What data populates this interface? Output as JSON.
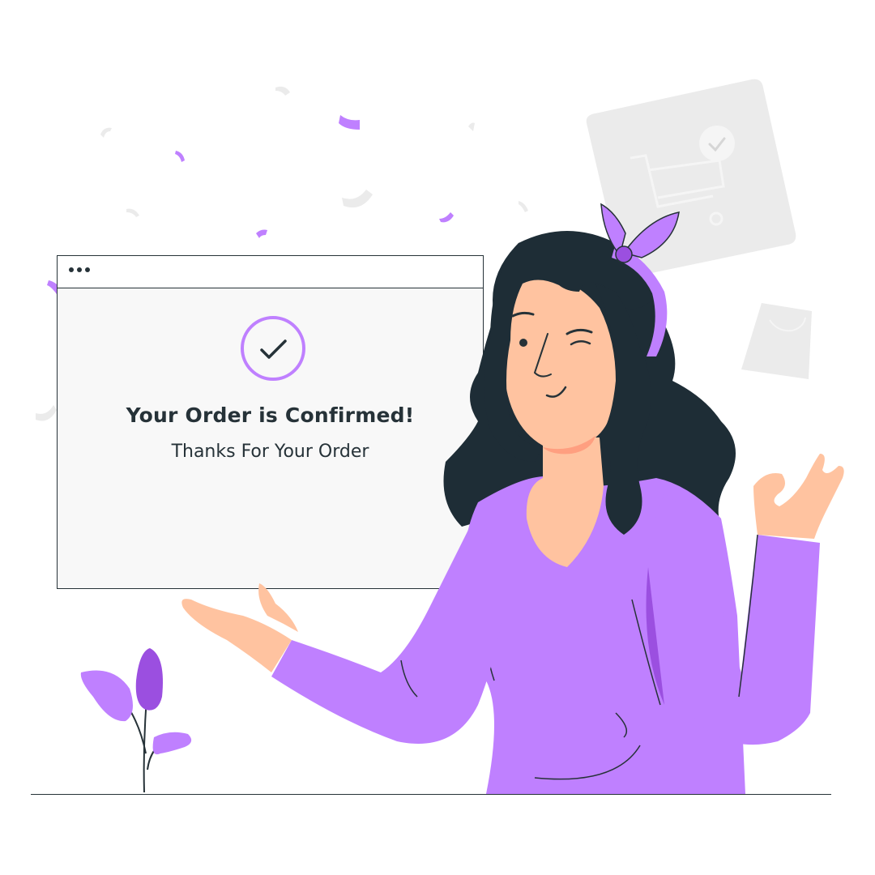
{
  "confirmation": {
    "title": "Your Order is Confirmed!",
    "subtitle": "Thanks For Your Order"
  },
  "icons": {
    "window_controls": "window-dots-icon",
    "badge": "check-circle-icon",
    "background_card": "shopping-cart-card-icon",
    "bag": "shopping-bag-icon"
  },
  "colors": {
    "accent": "#BF80FF",
    "accent_dark": "#9B4FE0",
    "ink": "#263238",
    "panel": "#F8F8F8",
    "skin": "#FFC3A0",
    "hair": "#1E2D36",
    "muted_gray": "#EBEBEB"
  }
}
